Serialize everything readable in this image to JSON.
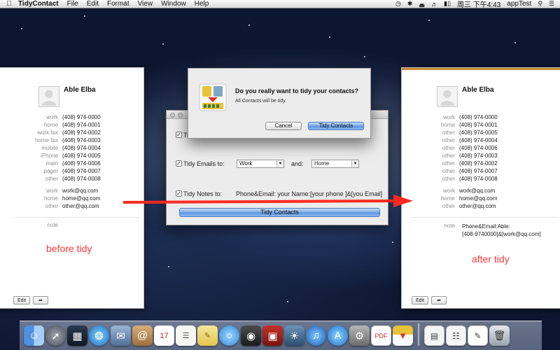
{
  "menubar": {
    "app_name": "TidyContact",
    "menus": [
      "File",
      "Edit",
      "Format",
      "View",
      "Window",
      "Help"
    ],
    "clock": "周三 下午4:43",
    "user": "appTest"
  },
  "left_card": {
    "name": "Able Elba",
    "phones": [
      {
        "label": "work",
        "value": "(408) 974-0000"
      },
      {
        "label": "home",
        "value": "(408) 974-0001"
      },
      {
        "label": "work fax",
        "value": "(408) 974-0002"
      },
      {
        "label": "home fax",
        "value": "(408) 974-0003"
      },
      {
        "label": "mobile",
        "value": "(408) 974-0004"
      },
      {
        "label": "iPhone",
        "value": "(408) 974-0005"
      },
      {
        "label": "main",
        "value": "(408) 974-0006"
      },
      {
        "label": "pager",
        "value": "(408) 974-0007"
      },
      {
        "label": "other",
        "value": "(408) 974-0008"
      }
    ],
    "emails": [
      {
        "label": "work",
        "value": "work@qq.com"
      },
      {
        "label": "home",
        "value": "home@qq.com"
      },
      {
        "label": "other",
        "value": "other@qq.com"
      }
    ],
    "note_label": "note",
    "note_value": "",
    "caption": "before tidy",
    "edit_label": "Edit"
  },
  "right_card": {
    "name": "Able Elba",
    "phones": [
      {
        "label": "work",
        "value": "(408) 974-0000"
      },
      {
        "label": "home",
        "value": "(408) 974-0001"
      },
      {
        "label": "other",
        "value": "(408) 974-0005"
      },
      {
        "label": "other",
        "value": "(408) 974-0004"
      },
      {
        "label": "other",
        "value": "(408) 974-0006"
      },
      {
        "label": "other",
        "value": "(408) 974-0003"
      },
      {
        "label": "other",
        "value": "(408) 974-0002"
      },
      {
        "label": "other",
        "value": "(408) 974-0007"
      },
      {
        "label": "other",
        "value": "(408) 974-0008"
      }
    ],
    "emails": [
      {
        "label": "work",
        "value": "work@qq.com"
      },
      {
        "label": "home",
        "value": "home@qq.com"
      },
      {
        "label": "other",
        "value": "other@qq.com"
      }
    ],
    "note_label": "note",
    "note_line1": "Phone&Email:Able:",
    "note_line2": "[408-9740000]&[work@qq.com]",
    "caption": "after tidy",
    "edit_label": "Edit"
  },
  "tidy_window": {
    "row1_label": "Tid",
    "emails_label": "Tidy Emails to:",
    "emails_first": "Work",
    "and_label": "and:",
    "emails_second": "Home",
    "notes_label": "Tidy Notes to:",
    "notes_value": "Phone&Email: your Name:[your phone ]&[you Email]",
    "button_label": "Tidy Contacts"
  },
  "dialog": {
    "title": "Do you really want to tidy your contacts?",
    "message": "All Contacts will be tidy.",
    "cancel_label": "Cancel",
    "confirm_label": "Tidy Contacts"
  },
  "dock": {
    "items": [
      "finder",
      "launchpad",
      "mission-control",
      "safari",
      "mail",
      "contacts",
      "calendar",
      "reminders",
      "notes",
      "messages",
      "facetime",
      "photo-booth",
      "iphoto",
      "itunes",
      "app-store",
      "system-preferences",
      "pdf-app",
      "tidycontact",
      "documents",
      "preview",
      "textedit",
      "trash"
    ],
    "pdf_label": "PDF"
  }
}
